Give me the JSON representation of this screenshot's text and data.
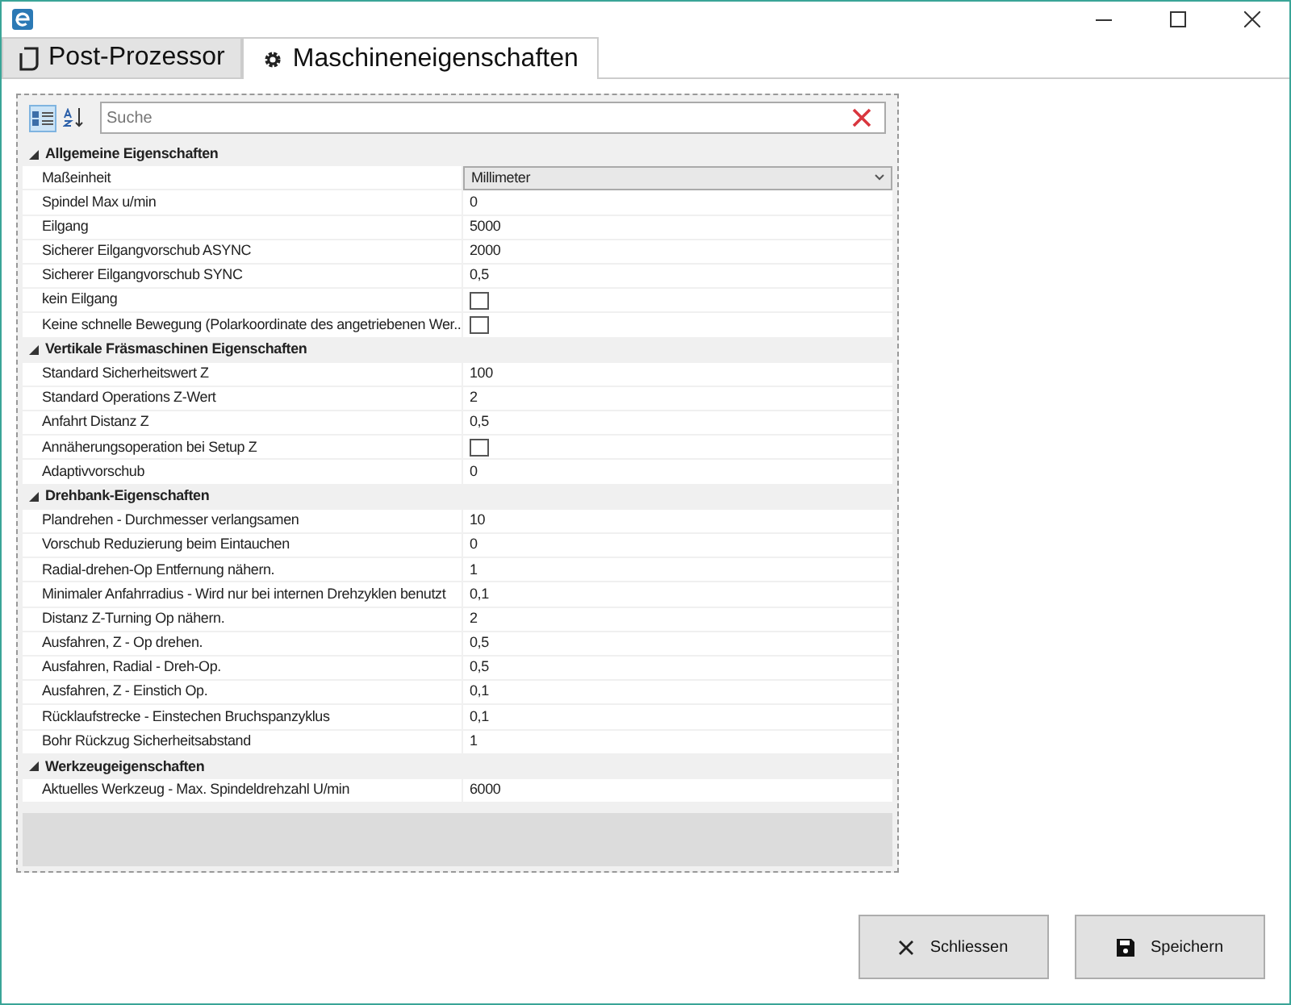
{
  "tabs": [
    {
      "label": "Post-Prozessor",
      "selected": false
    },
    {
      "label": "Maschineneigenschaften",
      "selected": true
    }
  ],
  "toolbar": {
    "categorized": {
      "selected": true
    },
    "alphabetical": {
      "selected": false
    },
    "search": {
      "placeholder": "Suche"
    }
  },
  "groups": [
    {
      "title": "Allgemeine Eigenschaften",
      "expanded": true,
      "rows": [
        {
          "label": "Maßeinheit",
          "kind": "dropdown",
          "value": "Millimeter"
        },
        {
          "label": "Spindel Max u/min",
          "kind": "text",
          "value": "0"
        },
        {
          "label": "Eilgang",
          "kind": "text",
          "value": "5000"
        },
        {
          "label": "Sicherer Eilgangvorschub ASYNC",
          "kind": "text",
          "value": "2000"
        },
        {
          "label": "Sicherer Eilgangvorschub SYNC",
          "kind": "text",
          "value": "0,5"
        },
        {
          "label": "kein Eilgang",
          "kind": "checkbox",
          "checked": false
        },
        {
          "label": "Keine schnelle Bewegung (Polarkoordinate des angetriebenen Wer...",
          "kind": "checkbox",
          "checked": false
        }
      ]
    },
    {
      "title": "Vertikale Fräsmaschinen Eigenschaften",
      "expanded": true,
      "rows": [
        {
          "label": "Standard Sicherheitswert Z",
          "kind": "text",
          "value": "100"
        },
        {
          "label": "Standard Operations Z-Wert",
          "kind": "text",
          "value": "2"
        },
        {
          "label": "Anfahrt Distanz Z",
          "kind": "text",
          "value": "0,5"
        },
        {
          "label": "Annäherungsoperation bei Setup Z",
          "kind": "checkbox",
          "checked": false
        },
        {
          "label": "Adaptivvorschub",
          "kind": "text",
          "value": "0"
        }
      ]
    },
    {
      "title": "Drehbank-Eigenschaften",
      "expanded": true,
      "rows": [
        {
          "label": "Plandrehen - Durchmesser verlangsamen",
          "kind": "text",
          "value": "10"
        },
        {
          "label": "Vorschub Reduzierung beim Eintauchen",
          "kind": "text",
          "value": "0"
        },
        {
          "label": "Radial-drehen-Op Entfernung nähern.",
          "kind": "text",
          "value": "1"
        },
        {
          "label": "Minimaler Anfahrradius - Wird nur bei internen Drehzyklen benutzt",
          "kind": "text",
          "value": "0,1"
        },
        {
          "label": "Distanz Z-Turning Op nähern.",
          "kind": "text",
          "value": "2"
        },
        {
          "label": "Ausfahren, Z - Op drehen.",
          "kind": "text",
          "value": "0,5"
        },
        {
          "label": "Ausfahren, Radial - Dreh-Op.",
          "kind": "text",
          "value": "0,5"
        },
        {
          "label": "Ausfahren, Z - Einstich Op.",
          "kind": "text",
          "value": "0,1"
        },
        {
          "label": "Rücklaufstrecke - Einstechen Bruchspanzyklus",
          "kind": "text",
          "value": "0,1"
        },
        {
          "label": "Bohr Rückzug Sicherheitsabstand",
          "kind": "text",
          "value": "1"
        }
      ]
    },
    {
      "title": "Werkzeugeigenschaften",
      "expanded": true,
      "rows": [
        {
          "label": "Aktuelles Werkzeug - Max. Spindeldrehzahl U/min",
          "kind": "text",
          "value": "6000"
        }
      ]
    }
  ],
  "buttons": [
    {
      "label": "Schliessen"
    },
    {
      "label": "Speichern"
    }
  ]
}
